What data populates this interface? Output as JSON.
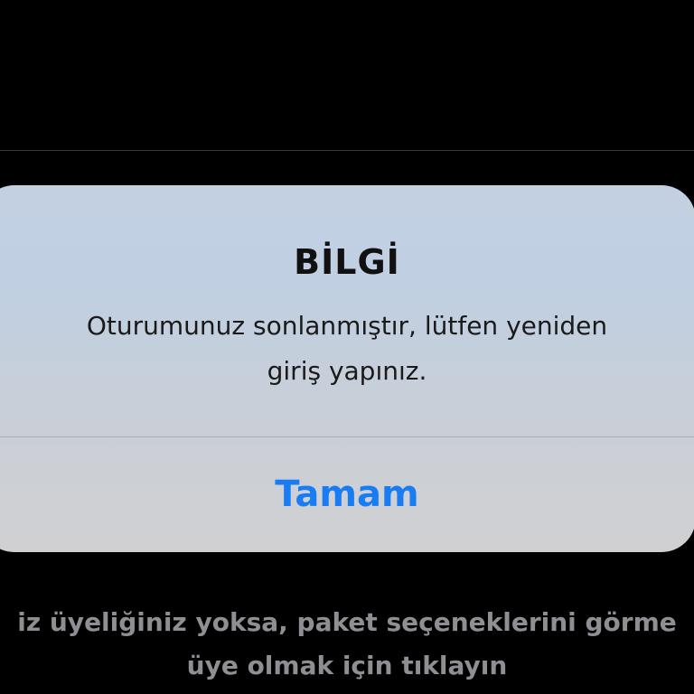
{
  "alert": {
    "title": "BİLGİ",
    "message": "Oturumunuz sonlanmıştır, lütfen yeniden giriş yapınız.",
    "button_label": "Tamam"
  },
  "background": {
    "line1": "iz üyeliğiniz yoksa, paket seçeneklerini görme",
    "line2": "üye olmak için tıklayın"
  },
  "colors": {
    "accent": "#1a7cf2",
    "background": "#000000",
    "muted_text": "#8e8e93"
  }
}
